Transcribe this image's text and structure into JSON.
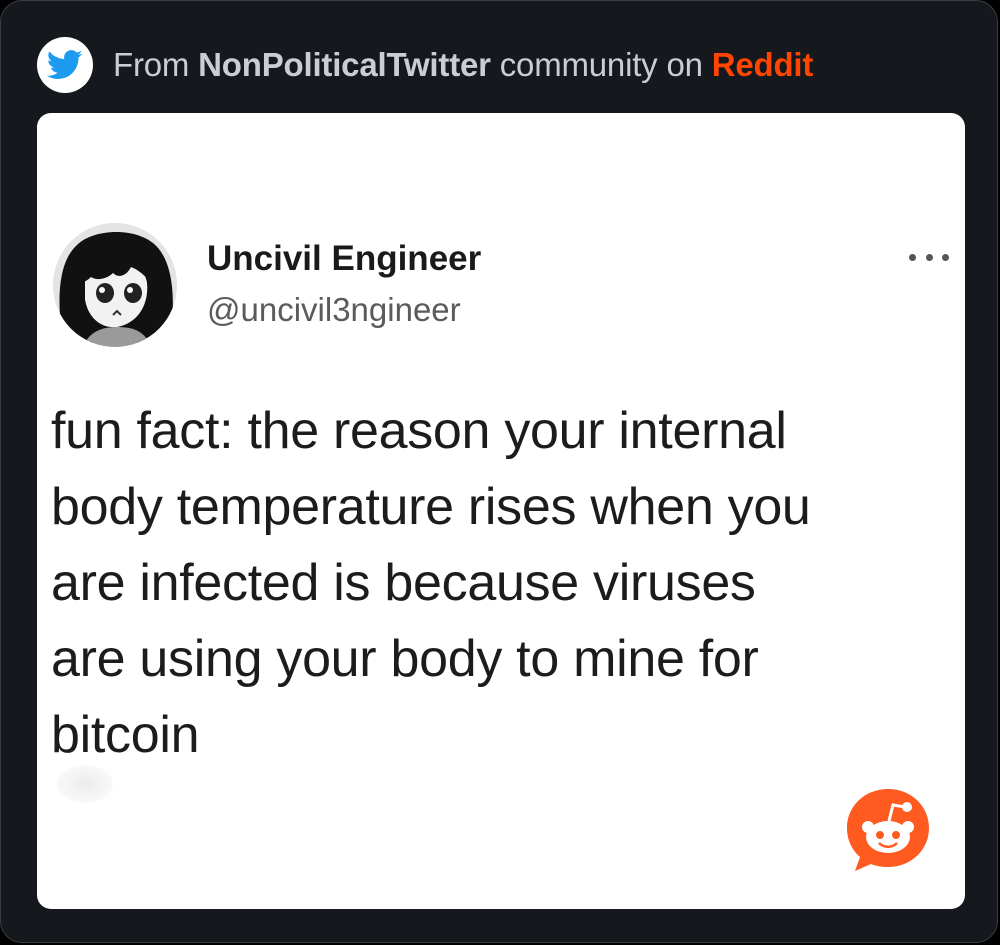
{
  "header": {
    "prefix": "From ",
    "community": "NonPoliticalTwitter",
    "middle": " community on ",
    "platform": "Reddit",
    "icon": "twitter-bird-icon"
  },
  "tweet": {
    "author_name": "Uncivil Engineer",
    "author_handle": "@uncivil3ngineer",
    "avatar_icon": "anime-girl-avatar",
    "more_icon": "more-dots-icon",
    "lines": [
      "fun fact: the reason your internal",
      "body temperature rises when you",
      "are infected is because viruses",
      "are using your body to mine for",
      "bitcoin"
    ]
  },
  "watermark_icon": "reddit-snoo-icon",
  "colors": {
    "background": "#15181c",
    "card": "#ffffff",
    "reddit_orange": "#ff4500",
    "twitter_blue": "#1d9bf0"
  }
}
